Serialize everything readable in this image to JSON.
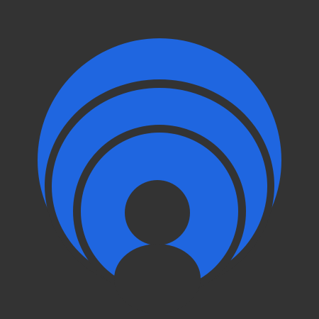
{
  "colors": {
    "background": "#333333",
    "accent": "#1F66E0"
  },
  "icon": {
    "semantic_name": "user-signal-icon"
  }
}
